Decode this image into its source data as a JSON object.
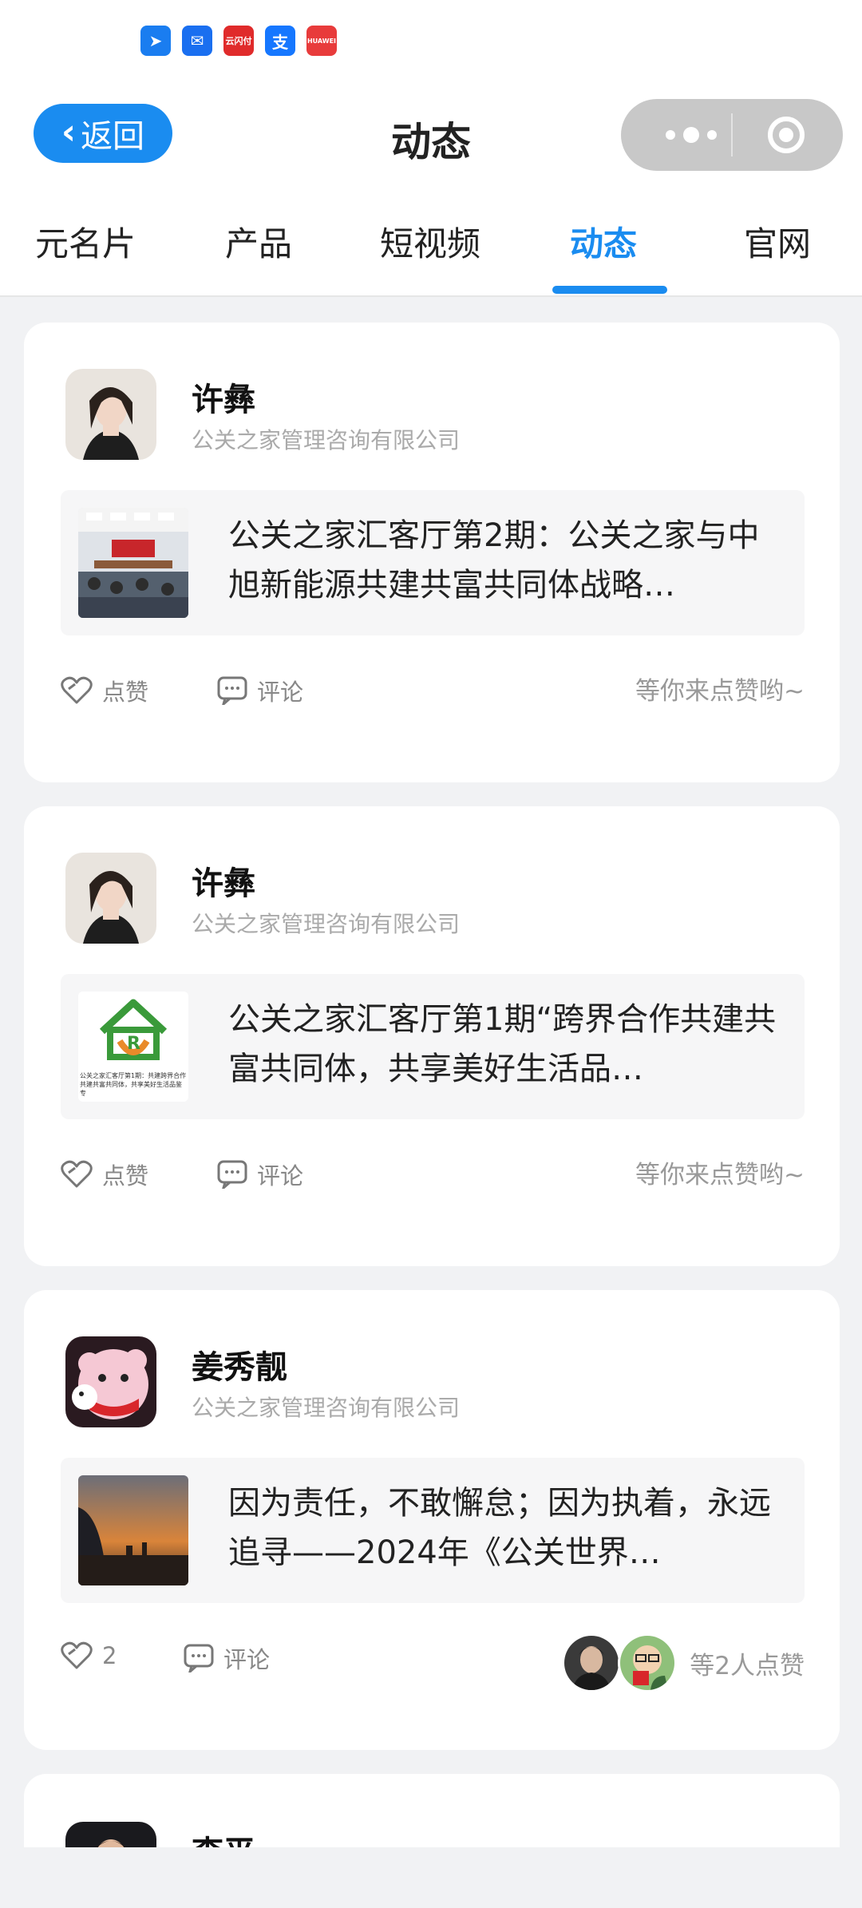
{
  "nav": {
    "back_label": "返回",
    "title": "动态"
  },
  "tabs": [
    {
      "label": "元名片",
      "active": false
    },
    {
      "label": "产品",
      "active": false
    },
    {
      "label": "短视频",
      "active": false
    },
    {
      "label": "动态",
      "active": true
    },
    {
      "label": "官网",
      "active": false
    }
  ],
  "status_icons": [
    "pointer-app-icon",
    "mail-icon",
    "yunshanfu-icon",
    "alipay-icon",
    "huawei-store-icon"
  ],
  "status_icon_text": {
    "yunshanfu": "云闪付",
    "alipay": "支",
    "huawei": "HUAWEI"
  },
  "posts": [
    {
      "author": "许彝",
      "company": "公关之家管理咨询有限公司",
      "text": "公关之家汇客厅第2期：公关之家与中旭新能源共建共富共同体战略…",
      "like_label": "点赞",
      "comment_label": "评论",
      "hint": "等你来点赞哟~"
    },
    {
      "author": "许彝",
      "company": "公关之家管理咨询有限公司",
      "text": "公关之家汇客厅第1期“跨界合作共建共富共同体，共享美好生活品…",
      "thumb_caption": "公关之家汇客厅第1期：共建跨界合作共建共富共同体，共享美好生活品鉴专",
      "like_label": "点赞",
      "comment_label": "评论",
      "hint": "等你来点赞哟~"
    },
    {
      "author": "姜秀靓",
      "company": "公关之家管理咨询有限公司",
      "text": "因为责任，不敢懈怠；因为执着，永远追寻——2024年《公关世界…",
      "like_count": "2",
      "comment_label": "评论",
      "likers_text": "等2人点赞"
    },
    {
      "author": "李平"
    }
  ],
  "colors": {
    "accent": "#1a8cf0",
    "background": "#f1f2f4"
  }
}
